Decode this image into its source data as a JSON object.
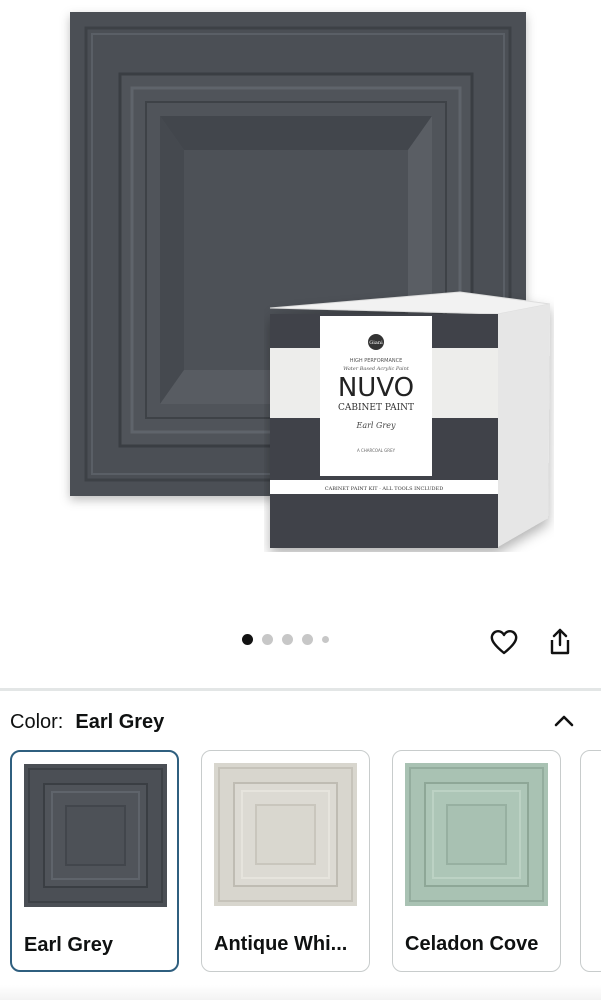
{
  "product_image": {
    "door_color": "#4b4f55",
    "box": {
      "brand": "NUVO",
      "subtitle": "CABINET PAINT",
      "shade": "Earl Grey",
      "tagline_top": "HIGH PERFORMANCE",
      "tagline_script": "Water Based Acrylic Paint",
      "small_text": "A CHARCOAL GREY",
      "band_text": "CABINET PAINT KIT · ALL TOOLS INCLUDED",
      "logo": "Giani"
    }
  },
  "carousel": {
    "dots": 5,
    "active_index": 0
  },
  "actions": {
    "favorite_icon": "heart-icon",
    "share_icon": "share-icon"
  },
  "color_selector": {
    "label": "Color:",
    "value": "Earl Grey",
    "collapse_icon": "chevron-up-icon",
    "options": [
      {
        "name": "Earl Grey",
        "color": "#4b4f55",
        "selected": true
      },
      {
        "name": "Antique Whi...",
        "color": "#d8d6ce",
        "selected": false
      },
      {
        "name": "Celadon Cove",
        "color": "#a9c2b3",
        "selected": false
      }
    ]
  },
  "colors": {
    "accent_border": "#2f5f7f",
    "divider": "#e3e6e6"
  }
}
